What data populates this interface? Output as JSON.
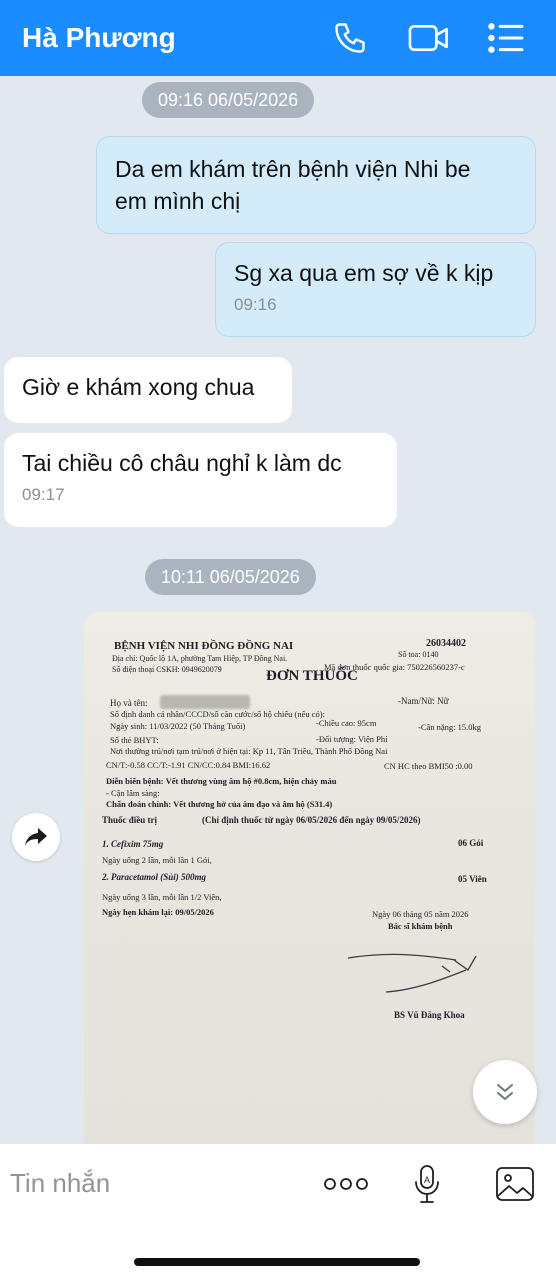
{
  "header": {
    "contact_name": "Hà Phương",
    "icons": [
      "phone-icon",
      "video-call-icon",
      "menu-list-icon"
    ]
  },
  "messages": [
    {
      "type": "time",
      "text": "09:16 06/05/2026"
    },
    {
      "type": "out",
      "text_line1": "Da em khám trên bệnh viện Nhi be",
      "text_line2": "em mình chị"
    },
    {
      "type": "out",
      "text": "Sg xa qua em sợ về k kịp",
      "time": "09:16"
    },
    {
      "type": "in",
      "text": "Giờ e khám xong chua"
    },
    {
      "type": "in",
      "text": "Tai chiều cô châu nghỉ k làm dc",
      "time": "09:17"
    },
    {
      "type": "time",
      "text": "10:11 06/05/2026"
    }
  ],
  "photo": {
    "hospital": "BỆNH VIỆN NHI ĐỒNG ĐỒNG NAI",
    "address": "Địa chỉ: Quốc lộ 1A, phường Tam Hiệp, TP Đồng Nai.",
    "phone": "Số điện thoại CSKH: 0949620079",
    "code_top": "26034402",
    "so_toa": "Số toa: 0140",
    "ma_don": "Mã đơn thuốc quốc gia: 750226560237-c",
    "doc_title": "ĐƠN THUỐC",
    "ho_ten": "Họ và tên:",
    "gioi_tinh": "-Nam/Nữ: Nữ",
    "cccd": "Số định danh cá nhân/CCCD/số căn cước/số hộ chiếu (nếu có):",
    "ngay_sinh": "Ngày sinh:    11/03/2022 (50 Tháng Tuổi)",
    "chieu_cao": "-Chiều cao: 95cm",
    "can_nang": "-Cân nặng: 15.0kg",
    "bhyt": "Số thẻ BHYT:",
    "doi_tuong": "-Đối tượng:    Viện Phí",
    "noi_thuong_tru": "Nơi thường trú/nơi tạm trú/nơi ở hiện tại: Kp 11, Tân Triều, Thành Phố Đồng Nai",
    "chi_so": "CN/T:-0.58    CC/T:-1.91 CN/CC:0.84    BMI:16.62",
    "cn_hc": "CN HC theo BMI50 :0.00",
    "dien_bien": "Diễn biến bệnh: Vết thương vùng âm hộ #0.8cm, hiện chảy máu",
    "can_lam_sang": "- Cận lâm sàng:",
    "chan_doan": "Chẩn đoán chính: Vết thương hở của âm đạo và âm hộ  (S31.4)",
    "thuoc_dieu_tri": "Thuốc điều trị",
    "chi_dinh": "(Chỉ định thuốc từ ngày 06/05/2026 đến ngày 09/05/2026)",
    "drug1": "1.  Cefixim 75mg",
    "drug1_qty": "06  Gói",
    "drug1_use": "Ngày uống 2 lần, mỗi lần 1 Gói,",
    "drug2": "2.  Paracetamol (Sủi) 500mg",
    "drug2_qty": "05  Viên",
    "drug2_use": "Ngày uống 3 lần, mỗi lần 1/2 Viên,",
    "hen_kham": "Ngày hẹn khám lại:         09/05/2026",
    "ngay_ky": "Ngày 06 tháng 05 năm 2026",
    "bac_si_label": "Bác sĩ khám bệnh",
    "bac_si_name": "BS Vũ Đăng Khoa"
  },
  "composer": {
    "placeholder": "Tin nhắn",
    "icons": [
      "more-options-icon",
      "voice-text-icon",
      "image-icon"
    ]
  },
  "colors": {
    "header": "#1a8cff",
    "outgoing": "#d4ebfa",
    "incoming": "#ffffff",
    "background": "#e2e8ef"
  }
}
